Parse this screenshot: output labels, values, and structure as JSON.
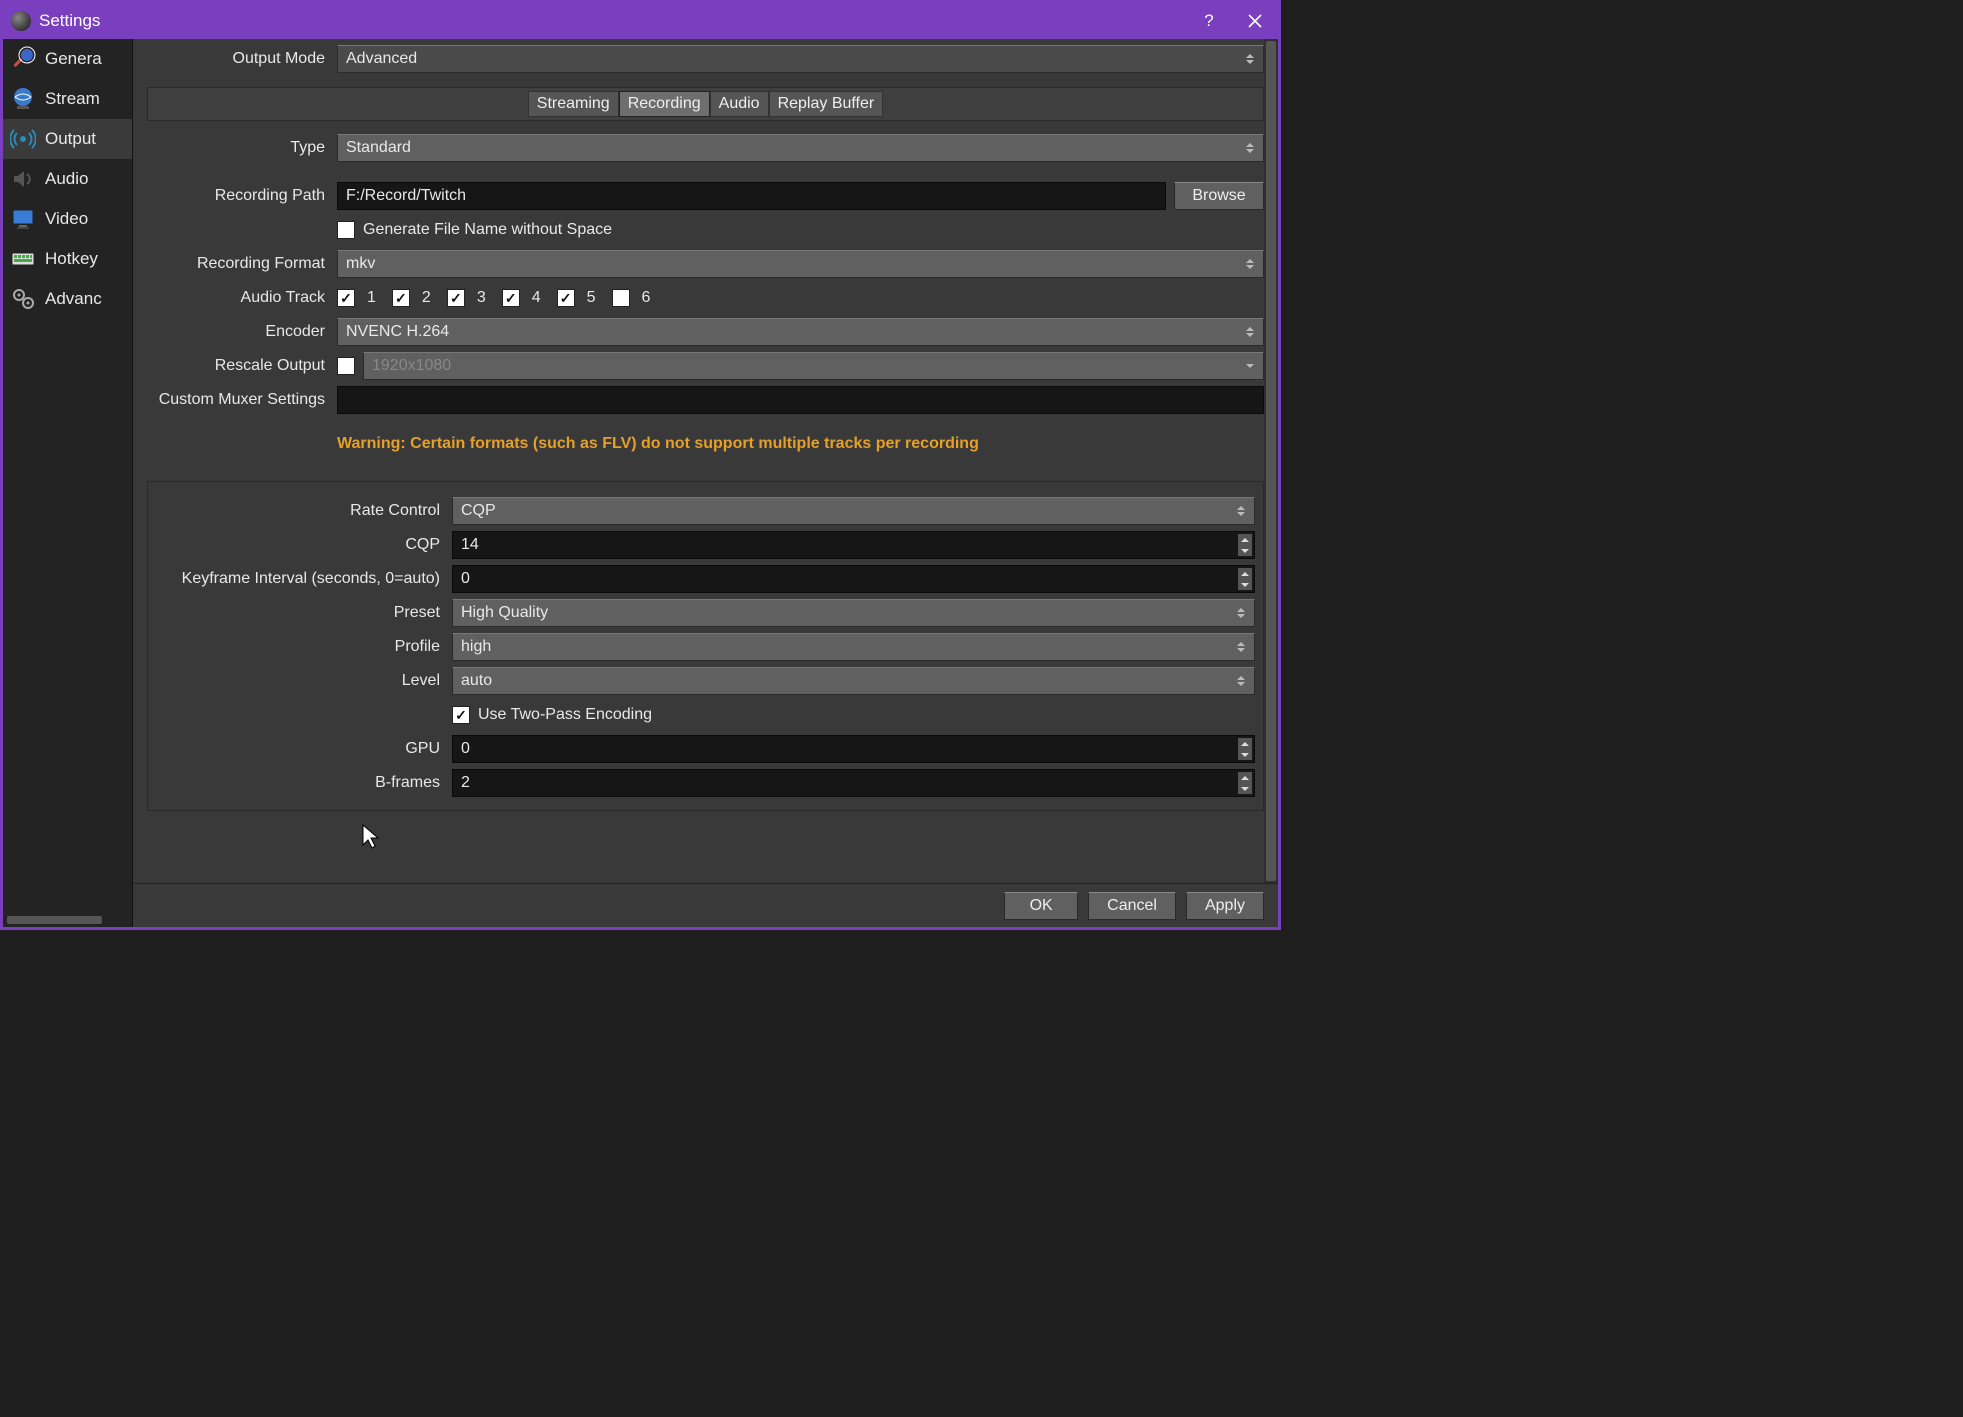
{
  "window": {
    "title": "Settings"
  },
  "sidebar": {
    "items": [
      {
        "label": "Genera"
      },
      {
        "label": "Stream"
      },
      {
        "label": "Output"
      },
      {
        "label": "Audio"
      },
      {
        "label": "Video"
      },
      {
        "label": "Hotkey"
      },
      {
        "label": "Advanc"
      }
    ]
  },
  "output_mode": {
    "label": "Output Mode",
    "value": "Advanced"
  },
  "tabs": {
    "streaming": "Streaming",
    "recording": "Recording",
    "audio": "Audio",
    "replay": "Replay Buffer"
  },
  "type": {
    "label": "Type",
    "value": "Standard"
  },
  "recording_path": {
    "label": "Recording Path",
    "value": "F:/Record/Twitch",
    "browse": "Browse"
  },
  "gen_noSpace": {
    "label": "Generate File Name without Space"
  },
  "recording_format": {
    "label": "Recording Format",
    "value": "mkv"
  },
  "audio_track": {
    "label": "Audio Track",
    "t1": "1",
    "t2": "2",
    "t3": "3",
    "t4": "4",
    "t5": "5",
    "t6": "6"
  },
  "encoder": {
    "label": "Encoder",
    "value": "NVENC H.264"
  },
  "rescale": {
    "label": "Rescale Output",
    "value": "1920x1080"
  },
  "muxer": {
    "label": "Custom Muxer Settings",
    "value": ""
  },
  "warning": "Warning: Certain formats (such as FLV) do not support multiple tracks per recording",
  "enc": {
    "rate_control": {
      "label": "Rate Control",
      "value": "CQP"
    },
    "cqp": {
      "label": "CQP",
      "value": "14"
    },
    "keyframe": {
      "label": "Keyframe Interval (seconds, 0=auto)",
      "value": "0"
    },
    "preset": {
      "label": "Preset",
      "value": "High Quality"
    },
    "profile": {
      "label": "Profile",
      "value": "high"
    },
    "level": {
      "label": "Level",
      "value": "auto"
    },
    "twopass": {
      "label": "Use Two-Pass Encoding"
    },
    "gpu": {
      "label": "GPU",
      "value": "0"
    },
    "bframes": {
      "label": "B-frames",
      "value": "2"
    }
  },
  "footer": {
    "ok": "OK",
    "cancel": "Cancel",
    "apply": "Apply"
  }
}
